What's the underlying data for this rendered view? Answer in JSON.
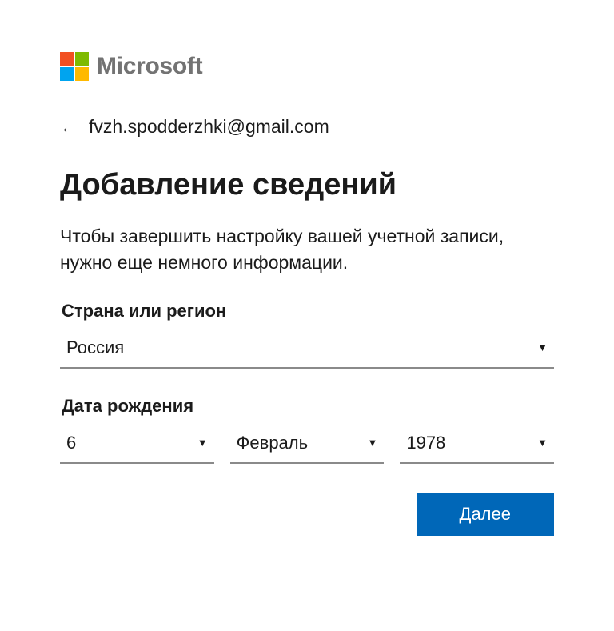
{
  "brand": {
    "name": "Microsoft"
  },
  "account": {
    "email": "fvzh.spodderzhki@gmail.com"
  },
  "heading": "Добавление сведений",
  "subtext": "Чтобы завершить настройку вашей учетной записи, нужно еще немного информации.",
  "fields": {
    "country": {
      "label": "Страна или регион",
      "value": "Россия"
    },
    "birthdate": {
      "label": "Дата рождения",
      "day": "6",
      "month": "Февраль",
      "year": "1978"
    }
  },
  "actions": {
    "next": "Далее"
  }
}
